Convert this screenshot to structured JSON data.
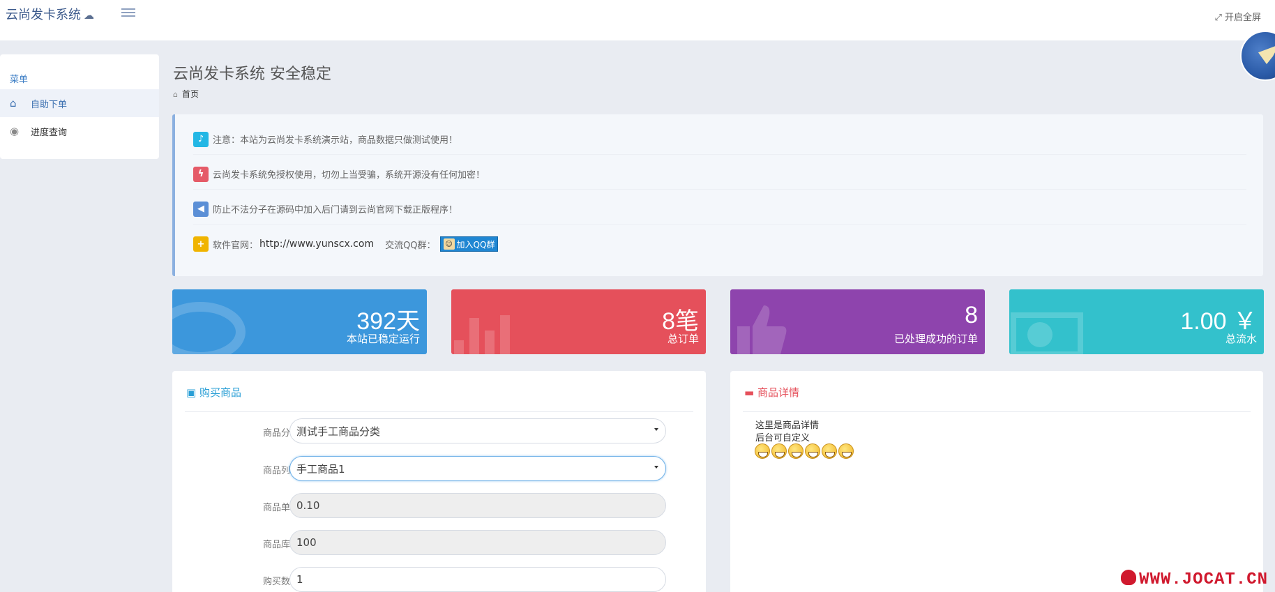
{
  "topbar": {
    "brand": "云尚发卡系统",
    "fullscreen_label": "开启全屏"
  },
  "sidebar": {
    "header": "菜单",
    "items": [
      {
        "label": "自助下单",
        "icon": "home-icon",
        "active": true
      },
      {
        "label": "进度查询",
        "icon": "eye-icon",
        "active": false
      }
    ]
  },
  "page": {
    "title": "云尚发卡系统 安全稳定",
    "breadcrumb": "首页"
  },
  "notices": [
    {
      "icon": "bell-icon",
      "color": "#23b7e5",
      "text": "注意：本站为云尚发卡系统演示站，商品数据只做测试使用！"
    },
    {
      "icon": "bolt-icon",
      "color": "#e55b68",
      "text": "云尚发卡系统免授权使用，切勿上当受骗，系统开源没有任何加密！"
    },
    {
      "icon": "megaphone-icon",
      "color": "#5b8fd6",
      "text": "防止不法分子在源码中加入后门请到云尚官网下载正版程序！"
    },
    {
      "icon": "plus-icon",
      "color": "#f0b400",
      "text": "软件官网：",
      "url": "http://www.yunscx.com",
      "qq_label": "交流QQ群：",
      "qq_button": "加入QQ群"
    }
  ],
  "stats": [
    {
      "value": "392天",
      "label": "本站已稳定运行",
      "color": "#3c97dc"
    },
    {
      "value": "8笔",
      "label": "总订单",
      "color": "#e5505b"
    },
    {
      "value": "8",
      "label": "已处理成功的订单",
      "color": "#8e44ad"
    },
    {
      "value": "1.00 ￥",
      "label": "总流水",
      "color": "#33c1cc"
    }
  ],
  "buy": {
    "title": "购买商品",
    "fields": [
      {
        "label": "商品分类",
        "value": "测试手工商品分类",
        "type": "select"
      },
      {
        "label": "商品列表",
        "value": "手工商品1",
        "type": "select"
      },
      {
        "label": "商品单价",
        "value": "0.10",
        "type": "readonly"
      },
      {
        "label": "商品库存",
        "value": "100",
        "type": "readonly"
      },
      {
        "label": "购买数量",
        "value": "1",
        "type": "input"
      }
    ]
  },
  "detail": {
    "title": "商品详情",
    "line1": "这里是商品详情",
    "line2": "后台可自定义",
    "emoji_count": 6
  },
  "watermark": "WWW.JOCAT.CN"
}
